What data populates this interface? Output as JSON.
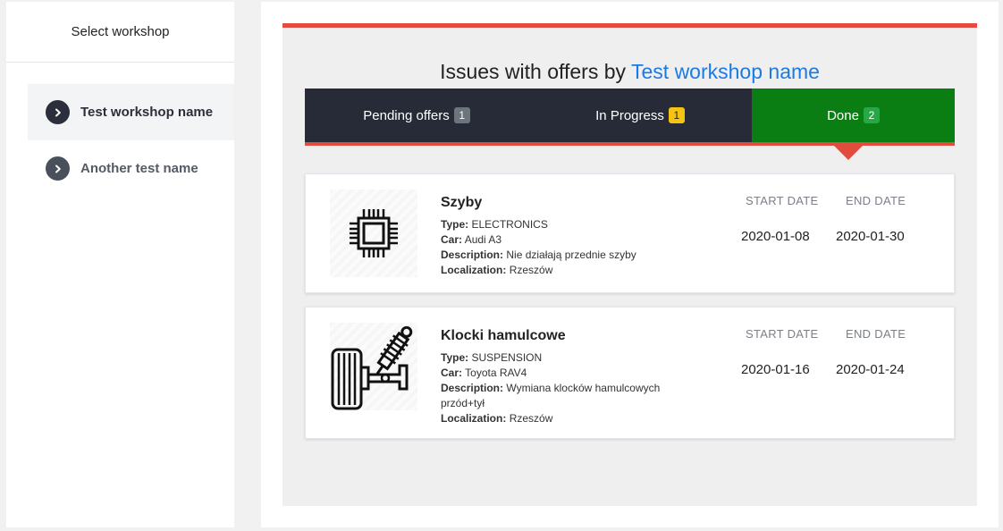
{
  "sidebar": {
    "title": "Select workshop",
    "items": [
      {
        "label": "Test workshop name"
      },
      {
        "label": "Another test name"
      }
    ]
  },
  "main": {
    "heading_prefix": "Issues with offers by",
    "heading_link": "Test workshop name",
    "tabs": [
      {
        "label": "Pending offers",
        "count": "1"
      },
      {
        "label": "In Progress",
        "count": "1"
      },
      {
        "label": "Done",
        "count": "2"
      }
    ],
    "columns": {
      "start": "START DATE",
      "end": "END DATE"
    },
    "issues": [
      {
        "title": "Szyby",
        "type_label": "Type:",
        "type": "ELECTRONICS",
        "car_label": "Car:",
        "car": "Audi A3",
        "description_label": "Description:",
        "description": "Nie działają przednie szyby",
        "localization_label": "Localization:",
        "localization": "Rzeszów",
        "start_date": "2020-01-08",
        "end_date": "2020-01-30",
        "icon": "chip-icon"
      },
      {
        "title": "Klocki hamulcowe",
        "type_label": "Type:",
        "type": "SUSPENSION",
        "car_label": "Car:",
        "car": "Toyota RAV4",
        "description_label": "Description:",
        "description": "Wymiana klocków hamulcowych przód+tył",
        "localization_label": "Localization:",
        "localization": "Rzeszów",
        "start_date": "2020-01-16",
        "end_date": "2020-01-24",
        "icon": "suspension-icon"
      }
    ]
  },
  "colors": {
    "accent_red": "#e24c3f",
    "tab_dark": "#262b37",
    "tab_done": "#0a7e12",
    "link_blue": "#1a7ae6"
  }
}
